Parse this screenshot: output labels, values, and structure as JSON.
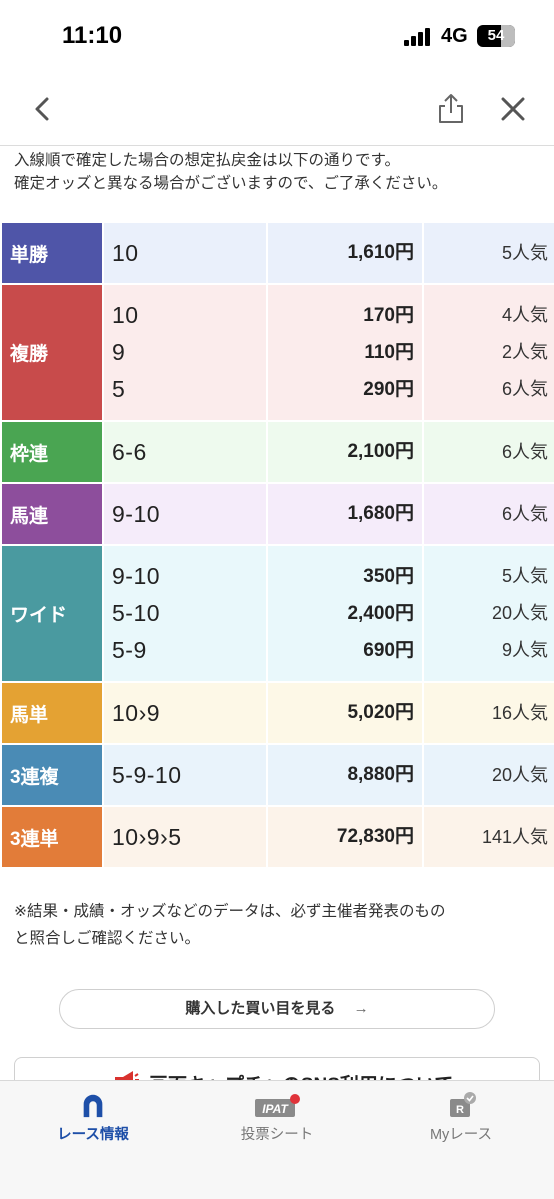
{
  "status_bar": {
    "time": "11:10",
    "network": "4G",
    "battery": "54"
  },
  "nav": {
    "back_icon": "chevron-left-icon",
    "share_icon": "share-icon",
    "close_icon": "close-icon"
  },
  "notice": {
    "line1": "入線順で確定した場合の想定払戻金は以下の通りです。",
    "line2": "確定オッズと異なる場合がございますので、ご了承ください。"
  },
  "colors": {
    "tansho": "#4f55a8",
    "fukusho": "#c84b4b",
    "wakuren": "#4aa552",
    "umaren": "#8d4e9c",
    "wide": "#4a9aa0",
    "umatan": "#e4a233",
    "sanrenpuku": "#4a8bb5",
    "sanrentan": "#e27c39"
  },
  "rows": [
    {
      "label": "単勝",
      "color": "#4f55a8",
      "bg": "#eaf0fb",
      "numbers": [
        "10"
      ],
      "payouts": [
        "1,610円"
      ],
      "popularity": [
        "5人気"
      ]
    },
    {
      "label": "複勝",
      "color": "#c84b4b",
      "bg": "#fbecec",
      "numbers": [
        "10",
        "9",
        "5"
      ],
      "payouts": [
        "170円",
        "110円",
        "290円"
      ],
      "popularity": [
        "4人気",
        "2人気",
        "6人気"
      ]
    },
    {
      "label": "枠連",
      "color": "#4aa552",
      "bg": "#eefaee",
      "numbers": [
        "6-6"
      ],
      "payouts": [
        "2,100円"
      ],
      "popularity": [
        "6人気"
      ]
    },
    {
      "label": "馬連",
      "color": "#8d4e9c",
      "bg": "#f5ecfa",
      "numbers": [
        "9-10"
      ],
      "payouts": [
        "1,680円"
      ],
      "popularity": [
        "6人気"
      ]
    },
    {
      "label": "ワイド",
      "color": "#4a9aa0",
      "bg": "#e9f8fb",
      "numbers": [
        "9-10",
        "5-10",
        "5-9"
      ],
      "payouts": [
        "350円",
        "2,400円",
        "690円"
      ],
      "popularity": [
        "5人気",
        "20人気",
        "9人気"
      ]
    },
    {
      "label": "馬単",
      "color": "#e4a233",
      "bg": "#fdf8e7",
      "numbers": [
        "10›9"
      ],
      "payouts": [
        "5,020円"
      ],
      "popularity": [
        "16人気"
      ]
    },
    {
      "label": "3連複",
      "color": "#4a8bb5",
      "bg": "#e9f3fb",
      "numbers": [
        "5-9-10"
      ],
      "payouts": [
        "8,880円"
      ],
      "popularity": [
        "20人気"
      ]
    },
    {
      "label": "3連単",
      "color": "#e27c39",
      "bg": "#fcf3ea",
      "numbers": [
        "10›9›5"
      ],
      "payouts": [
        "72,830円"
      ],
      "popularity": [
        "141人気"
      ]
    }
  ],
  "footnote": {
    "line1": "※結果・成績・オッズなどのデータは、必ず主催者発表のもの",
    "line2": "と照合しご確認ください。"
  },
  "buy_button": {
    "label": "購入した買い目を見る",
    "arrow": "→"
  },
  "sns_notice": {
    "label": "画面キャプチャのSNS利用について"
  },
  "tabs": [
    {
      "label": "レース情報",
      "icon": "horseshoe-icon",
      "active": true
    },
    {
      "label": "投票シート",
      "icon": "ipat-icon",
      "active": false,
      "icon_text": "IPAT"
    },
    {
      "label": "Myレース",
      "icon": "my-race-icon",
      "active": false,
      "icon_text": "R"
    }
  ]
}
